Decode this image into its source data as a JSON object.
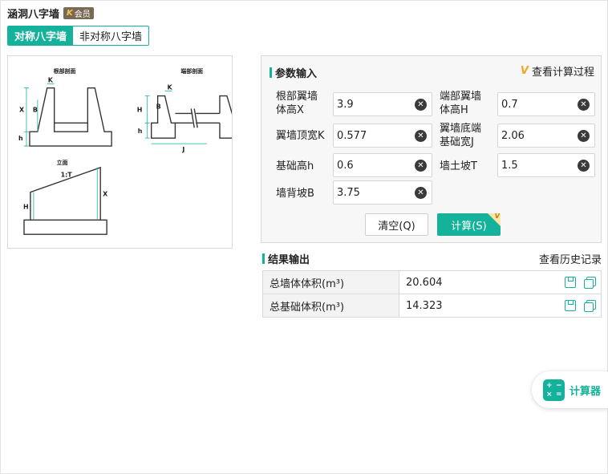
{
  "header": {
    "title": "涵洞八字墙",
    "badge": "会员"
  },
  "tabs": [
    {
      "label": "对称八字墙",
      "active": true
    },
    {
      "label": "非对称八字墙",
      "active": false
    }
  ],
  "diagram": {
    "root_section_title": "根部剖面",
    "end_section_title": "端部剖面",
    "elevation_title": "立面",
    "labels": {
      "K": "K",
      "X": "X",
      "B": "B",
      "h": "h",
      "H": "H",
      "J": "J",
      "slope": "1:T"
    }
  },
  "params": {
    "section_title": "参数输入",
    "process_link": "查看计算过程",
    "fields": [
      {
        "label_line1": "根部翼墙",
        "label_line2": "体高X",
        "value": "3.9"
      },
      {
        "label_line1": "端部翼墙",
        "label_line2": "体高H",
        "value": "0.7"
      },
      {
        "label_line1": "翼墙顶宽K",
        "label_line2": "",
        "value": "0.577"
      },
      {
        "label_line1": "翼墙底端",
        "label_line2": "基础宽J",
        "value": "2.06"
      },
      {
        "label_line1": "基础高h",
        "label_line2": "",
        "value": "0.6"
      },
      {
        "label_line1": "墙土坡T",
        "label_line2": "",
        "value": "1.5"
      },
      {
        "label_line1": "墙背坡B",
        "label_line2": "",
        "value": "3.75"
      }
    ],
    "clear_button": "清空(Q)",
    "calc_button": "计算(S)"
  },
  "results": {
    "section_title": "结果输出",
    "history_link": "查看历史记录",
    "rows": [
      {
        "name": "总墙体体积(m³)",
        "value": "20.604"
      },
      {
        "name": "总基础体积(m³)",
        "value": "14.323"
      }
    ]
  },
  "floating": {
    "calculator_label": "计算器"
  },
  "colors": {
    "accent": "#14b29a",
    "badge": "#7a6a55",
    "vip_mark": "#f5a623"
  }
}
